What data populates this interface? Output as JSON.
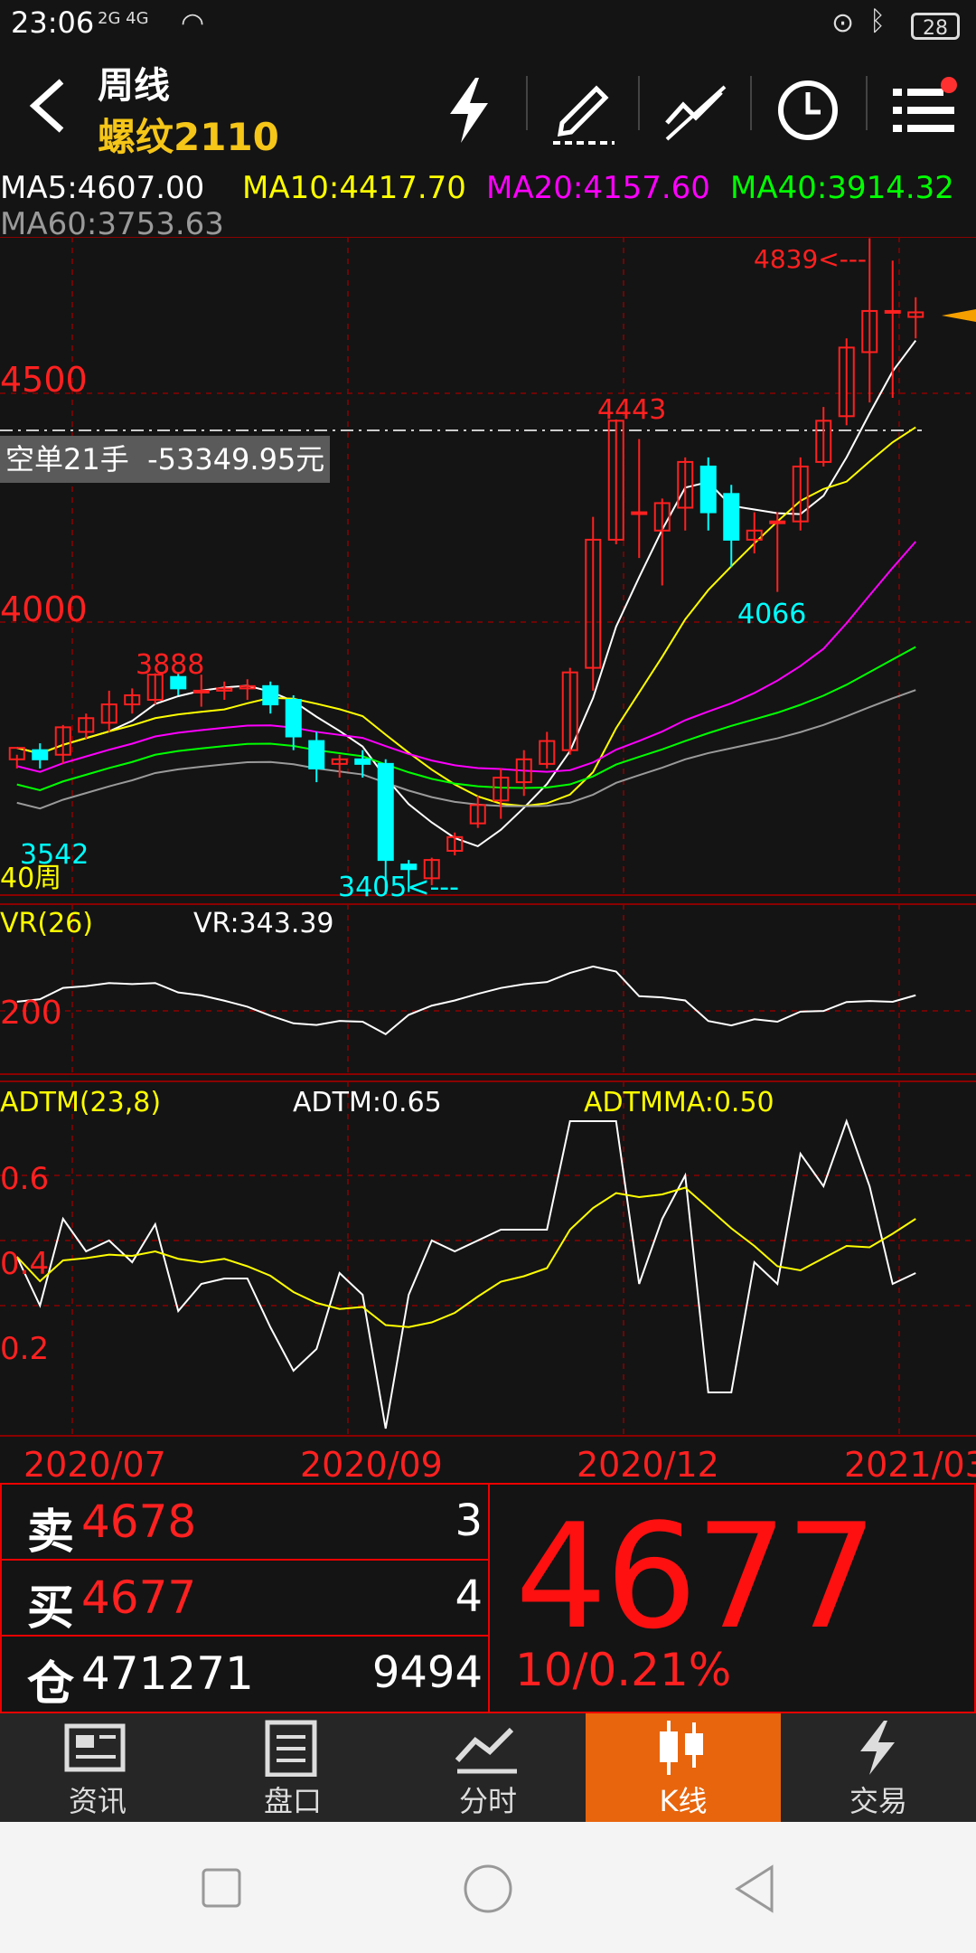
{
  "status_bar": {
    "time": "23:06",
    "signal": "2G 4G",
    "battery": "28"
  },
  "header": {
    "period": "周线",
    "symbol": "螺纹2110"
  },
  "ma": {
    "ma5": "MA5:4607.00",
    "ma10": "MA10:4417.70",
    "ma20": "MA20:4157.60",
    "ma40": "MA40:3914.32",
    "ma60": "MA60:3753.63"
  },
  "colors": {
    "up": "#ff2020",
    "down": "#00ffff",
    "ma5": "#ffffff",
    "ma10": "#ffff00",
    "ma20": "#ff00ff",
    "ma40": "#00ff00",
    "ma60": "#9a9a9a",
    "accent": "#e8650d"
  },
  "price_labels": {
    "p4500": "4500",
    "p4000": "4000"
  },
  "position_tag": "空单21手  -53349.95元",
  "annotations": {
    "high": "4839<---",
    "h4443": "4443",
    "h3888": "3888",
    "l3542": "3542",
    "l3405": "3405<---",
    "l4066": "4066",
    "ma_label": "40周"
  },
  "vr": {
    "name": "VR(26)",
    "value": "VR:343.39",
    "level": "200"
  },
  "adtm": {
    "name": "ADTM(23,8)",
    "value": "ADTM:0.65",
    "mavalue": "ADTMMA:0.50",
    "levels": [
      "0.6",
      "0.4",
      "0.2"
    ]
  },
  "dates": [
    "2020/07",
    "2020/09",
    "2020/12",
    "2021/03"
  ],
  "quote": {
    "sell_label": "卖",
    "sell_price": "4678",
    "sell_qty": "3",
    "buy_label": "买",
    "buy_price": "4677",
    "buy_qty": "4",
    "oi_label": "仓",
    "oi_value": "471271",
    "oi_change": "9494",
    "last": "4677",
    "change": "10/0.21%"
  },
  "nav": [
    {
      "label": "资讯",
      "icon": "news-icon"
    },
    {
      "label": "盘口",
      "icon": "orderbook-icon"
    },
    {
      "label": "分时",
      "icon": "intraday-icon"
    },
    {
      "label": "K线",
      "icon": "candlestick-icon",
      "active": true
    },
    {
      "label": "交易",
      "icon": "trade-icon"
    }
  ],
  "chart_data": {
    "type": "candlestick",
    "x": [
      "2020/07",
      "2020/09",
      "2020/12",
      "2021/03"
    ],
    "candles": [
      [
        3700,
        3725,
        3680,
        3710
      ],
      [
        3720,
        3700,
        3680,
        3735
      ],
      [
        3710,
        3770,
        3690,
        3775
      ],
      [
        3760,
        3790,
        3745,
        3800
      ],
      [
        3780,
        3820,
        3760,
        3850
      ],
      [
        3820,
        3840,
        3800,
        3855
      ],
      [
        3830,
        3885,
        3820,
        3888
      ],
      [
        3880,
        3855,
        3840,
        3890
      ],
      [
        3850,
        3850,
        3815,
        3885
      ],
      [
        3850,
        3855,
        3830,
        3870
      ],
      [
        3855,
        3860,
        3830,
        3875
      ],
      [
        3860,
        3820,
        3800,
        3870
      ],
      [
        3830,
        3750,
        3720,
        3840
      ],
      [
        3740,
        3680,
        3650,
        3760
      ],
      [
        3690,
        3700,
        3660,
        3710
      ],
      [
        3700,
        3690,
        3660,
        3720
      ],
      [
        3690,
        3480,
        3405,
        3700
      ],
      [
        3470,
        3460,
        3410,
        3480
      ],
      [
        3440,
        3480,
        3425,
        3485
      ],
      [
        3500,
        3530,
        3490,
        3540
      ],
      [
        3560,
        3600,
        3550,
        3620
      ],
      [
        3610,
        3660,
        3570,
        3680
      ],
      [
        3650,
        3700,
        3620,
        3720
      ],
      [
        3690,
        3740,
        3680,
        3760
      ],
      [
        3720,
        3890,
        3710,
        3900
      ],
      [
        3900,
        4180,
        3850,
        4230
      ],
      [
        4180,
        4440,
        4170,
        4443
      ],
      [
        4240,
        4240,
        4140,
        4400
      ],
      [
        4200,
        4260,
        4080,
        4270
      ],
      [
        4250,
        4350,
        4200,
        4360
      ],
      [
        4340,
        4240,
        4200,
        4360
      ],
      [
        4280,
        4180,
        4120,
        4300
      ],
      [
        4180,
        4200,
        4150,
        4240
      ],
      [
        4220,
        4220,
        4066,
        4240
      ],
      [
        4220,
        4340,
        4200,
        4360
      ],
      [
        4350,
        4440,
        4340,
        4470
      ],
      [
        4450,
        4600,
        4430,
        4620
      ],
      [
        4590,
        4680,
        4480,
        4839
      ],
      [
        4680,
        4680,
        4490,
        4790
      ],
      [
        4667,
        4677,
        4620,
        4710
      ]
    ]
  }
}
